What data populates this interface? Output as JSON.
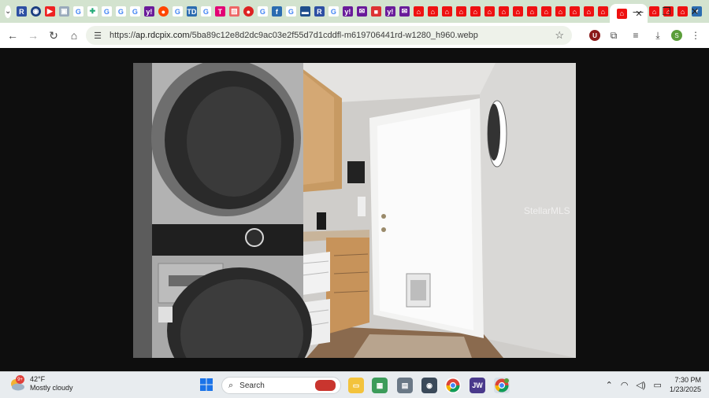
{
  "browser": {
    "active_tab_close": "✕",
    "new_tab": "+",
    "url_prefix": "https://",
    "url_host": "ap.rdcpix.com",
    "url_path": "/5ba89c12e8d2dc9ac03e2f55d7d1cddfl-m619706441rd-w1280_h960.webp",
    "window_controls": [
      "—",
      "❐",
      "✕"
    ]
  },
  "taskbar": {
    "weather_temp": "42°F",
    "weather_desc": "Mostly cloudy",
    "weather_badge": "9+",
    "search_placeholder": "Search",
    "time": "7:30 PM",
    "date": "1/23/2025",
    "jw_label": "JW"
  },
  "photo": {
    "watermark": "StellarMLS"
  },
  "colors": {
    "tabbar": "#d3e3cf",
    "viewer_bg": "#0e0e0e",
    "taskbar": "#e8ecef"
  }
}
